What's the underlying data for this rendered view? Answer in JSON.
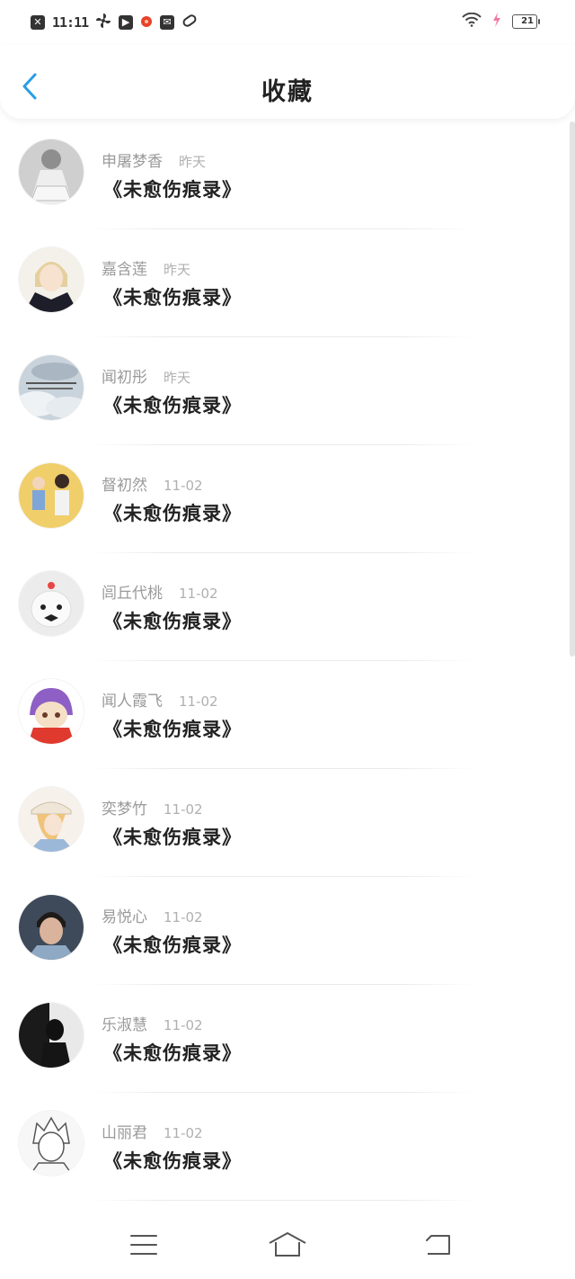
{
  "status_bar": {
    "time": "11:11",
    "battery": "21",
    "icons": [
      "close-box-icon",
      "fan-icon",
      "play-box-icon",
      "app-badge-icon",
      "mail-box-icon",
      "pill-icon",
      "wifi-icon",
      "charging-bolt-icon",
      "battery-icon"
    ]
  },
  "header": {
    "title": "收藏",
    "back_icon": "chevron-left-icon",
    "accent_color": "#2a9de8"
  },
  "favorites": [
    {
      "name": "申屠梦香",
      "time": "昨天",
      "book": "《未愈伤痕录》",
      "avatar": "gray-sketch"
    },
    {
      "name": "嘉含莲",
      "time": "昨天",
      "book": "《未愈伤痕录》",
      "avatar": "anime-boy"
    },
    {
      "name": "闻初彤",
      "time": "昨天",
      "book": "《未愈伤痕录》",
      "avatar": "clouds"
    },
    {
      "name": "督初然",
      "time": "11-02",
      "book": "《未愈伤痕录》",
      "avatar": "kids-yellow"
    },
    {
      "name": "闾丘代桃",
      "time": "11-02",
      "book": "《未愈伤痕录》",
      "avatar": "white-toy"
    },
    {
      "name": "闻人霞飞",
      "time": "11-02",
      "book": "《未愈伤痕录》",
      "avatar": "purple-anime"
    },
    {
      "name": "奕梦竹",
      "time": "11-02",
      "book": "《未愈伤痕录》",
      "avatar": "hat-girl"
    },
    {
      "name": "易悦心",
      "time": "11-02",
      "book": "《未愈伤痕录》",
      "avatar": "boy-portrait"
    },
    {
      "name": "乐淑慧",
      "time": "11-02",
      "book": "《未愈伤痕录》",
      "avatar": "dark-silhouette"
    },
    {
      "name": "山丽君",
      "time": "11-02",
      "book": "《未愈伤痕录》",
      "avatar": "manga-sketch"
    }
  ],
  "nav_bar": {
    "icons": [
      "menu-icon",
      "home-icon",
      "back-icon"
    ]
  }
}
